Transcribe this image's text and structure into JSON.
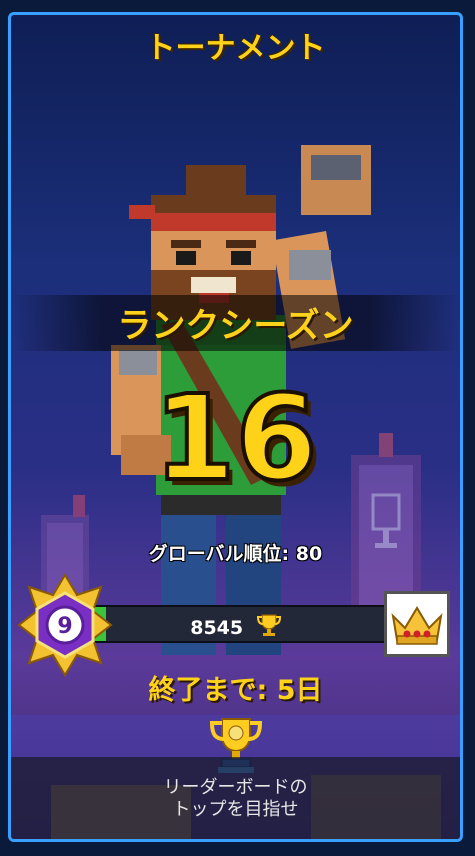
{
  "header": {
    "title": "トーナメント"
  },
  "season": {
    "label": "ランクシーズン",
    "rank": "16"
  },
  "global": {
    "label": "グローバル順位:",
    "value": "80"
  },
  "level": {
    "value": "9"
  },
  "progress": {
    "points": "8545",
    "fill_fraction": 0.06
  },
  "ends": {
    "label": "終了まで:",
    "value": "5日"
  },
  "footer": {
    "line1": "リーダーボードの",
    "line2": "トップを目指せ"
  },
  "colors": {
    "accent": "#ffd21a",
    "frame": "#3aa0ff",
    "bar_fill": "#3bc53b"
  },
  "icons": [
    "trophy-icon",
    "crown-icon",
    "level-badge-icon"
  ]
}
